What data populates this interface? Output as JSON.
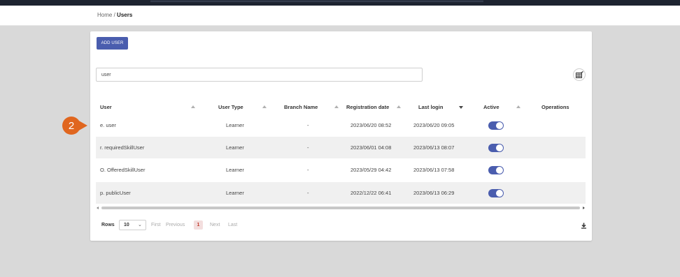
{
  "breadcrumb": {
    "home": "Home",
    "separator": "/",
    "current": "Users"
  },
  "toolbar": {
    "add_user_label": "ADD USER"
  },
  "search": {
    "value": "user"
  },
  "icons": {
    "column_selector": "table-column-select-icon",
    "download": "download-icon",
    "sort": "sort-arrow-icon"
  },
  "table": {
    "columns": [
      "User",
      "User Type",
      "Branch Name",
      "Registration date",
      "Last login",
      "Active",
      "Operations"
    ],
    "sorted_column": "Last login",
    "sort_direction": "descending",
    "rows": [
      {
        "user": "e. user",
        "type": "Learner",
        "branch": "-",
        "registered": "2023/06/20 08:52",
        "last_login": "2023/06/20 09:05",
        "active": true
      },
      {
        "user": "r. requiredSkillUser",
        "type": "Learner",
        "branch": "-",
        "registered": "2023/06/01 04:08",
        "last_login": "2023/06/13 08:07",
        "active": true
      },
      {
        "user": "O. OfferedSkillUser",
        "type": "Learner",
        "branch": "-",
        "registered": "2023/05/29 04:42",
        "last_login": "2023/06/13 07:58",
        "active": true
      },
      {
        "user": "p. publicUser",
        "type": "Learner",
        "branch": "-",
        "registered": "2022/12/22 06:41",
        "last_login": "2023/06/13 06:29",
        "active": true
      }
    ]
  },
  "paginator": {
    "rows_label": "Rows",
    "rows_per_page": "10",
    "first": "First",
    "previous": "Previous",
    "current_page": "1",
    "next": "Next",
    "last": "Last"
  },
  "annotation": {
    "step_number": "2"
  },
  "colors": {
    "accent": "#4a5dae",
    "marker": "#e0661f",
    "page_highlight": "#c0392b"
  }
}
